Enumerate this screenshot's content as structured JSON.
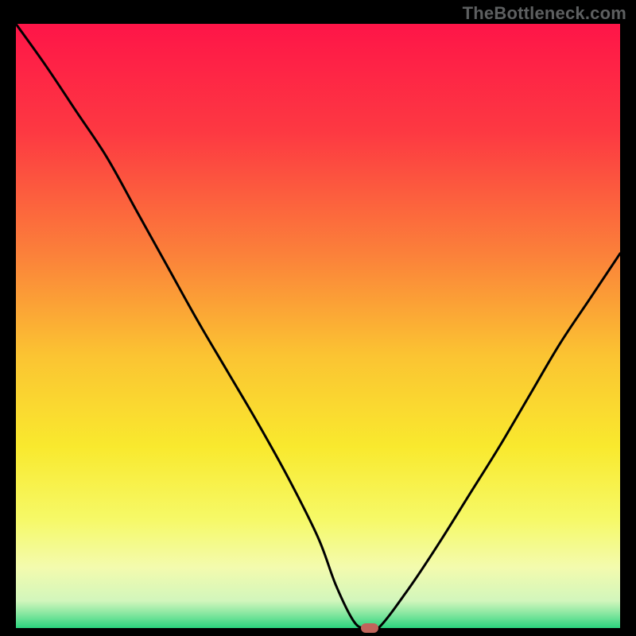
{
  "watermark": "TheBottleneck.com",
  "chart_data": {
    "type": "line",
    "title": "",
    "xlabel": "",
    "ylabel": "",
    "xlim": [
      0,
      100
    ],
    "ylim": [
      0,
      100
    ],
    "x": [
      0,
      5,
      10,
      15,
      20,
      25,
      30,
      35,
      40,
      45,
      50,
      53,
      56,
      58,
      60,
      65,
      70,
      75,
      80,
      85,
      90,
      95,
      100
    ],
    "values": [
      100,
      93,
      85.5,
      78,
      69,
      60,
      51,
      42.5,
      34,
      25,
      15,
      7,
      1,
      0,
      0,
      6.5,
      14,
      22,
      30,
      38.5,
      47,
      54.5,
      62
    ],
    "annotations": [
      {
        "type": "marker",
        "x": 58.5,
        "y": 0,
        "color": "#c1645b"
      }
    ],
    "background_gradient": {
      "stops": [
        {
          "pos": 0.0,
          "color": "#fe1548"
        },
        {
          "pos": 0.18,
          "color": "#fd3942"
        },
        {
          "pos": 0.38,
          "color": "#fb803a"
        },
        {
          "pos": 0.55,
          "color": "#fbc432"
        },
        {
          "pos": 0.7,
          "color": "#f9e92e"
        },
        {
          "pos": 0.82,
          "color": "#f6f967"
        },
        {
          "pos": 0.9,
          "color": "#f3fbae"
        },
        {
          "pos": 0.955,
          "color": "#d2f6bc"
        },
        {
          "pos": 0.975,
          "color": "#8ce8a2"
        },
        {
          "pos": 1.0,
          "color": "#2bd57e"
        }
      ]
    }
  }
}
